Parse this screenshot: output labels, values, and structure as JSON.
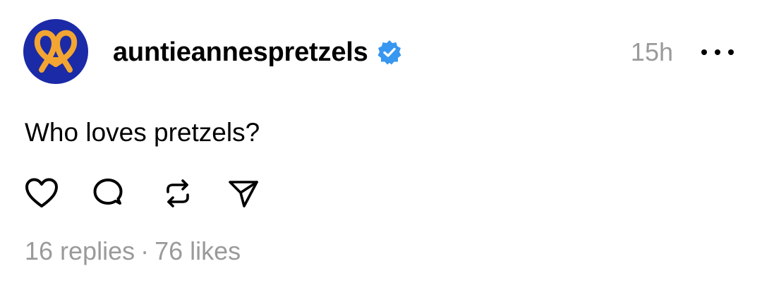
{
  "post": {
    "username": "auntieannespretzels",
    "verified": true,
    "timestamp": "15h",
    "text": "Who loves pretzels?",
    "replies_label": "16 replies",
    "separator": "·",
    "likes_label": "76 likes"
  },
  "icons": {
    "avatar": "pretzel-logo",
    "verified": "verified-badge-icon",
    "more": "more-options-icon",
    "like": "heart-icon",
    "reply": "comment-icon",
    "repost": "repost-icon",
    "share": "send-icon"
  },
  "colors": {
    "avatar_bg": "#1b2aa6",
    "pretzel": "#f2a531",
    "verified": "#3897f0",
    "muted_text": "#9a9a9a"
  }
}
